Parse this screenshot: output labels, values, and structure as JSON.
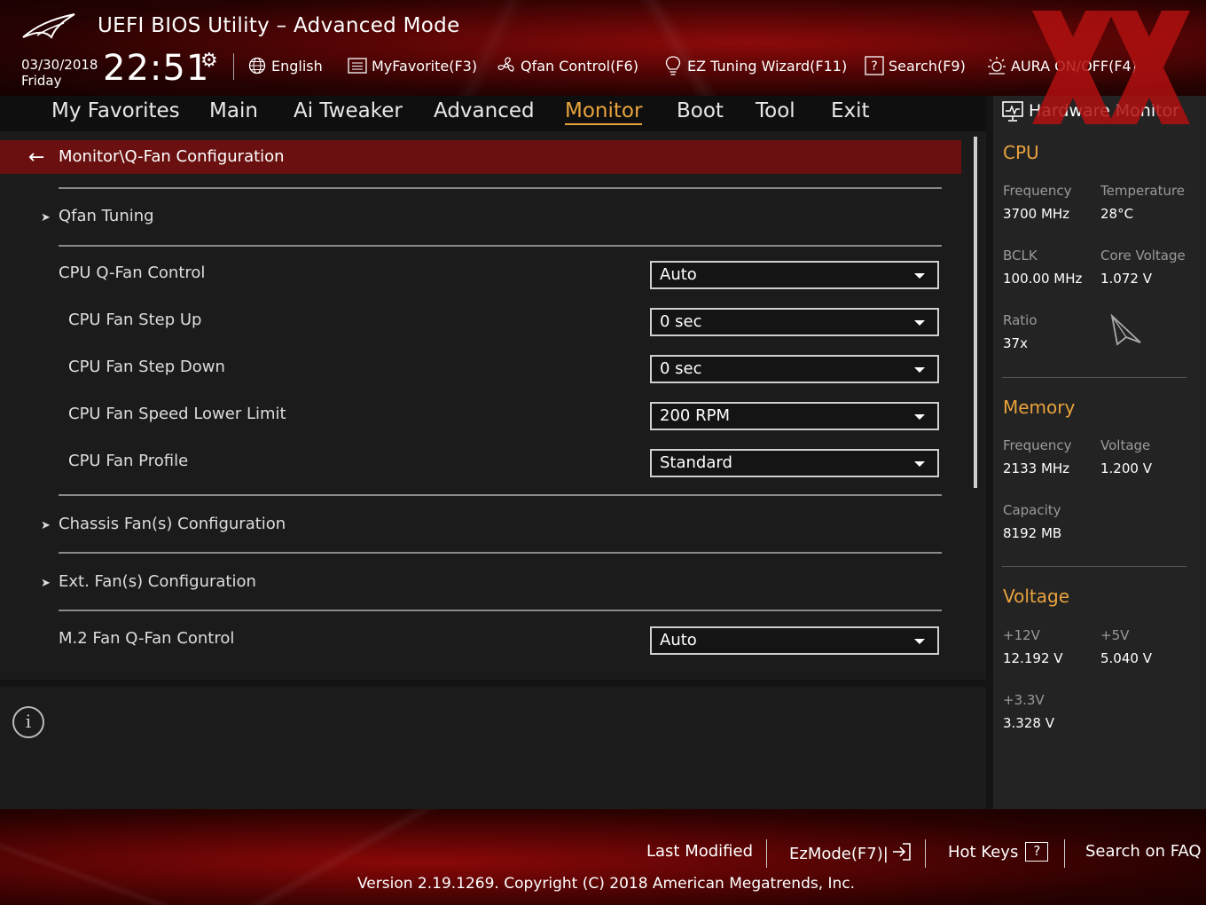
{
  "header": {
    "title": "UEFI BIOS Utility – Advanced Mode",
    "date": "03/30/2018",
    "day": "Friday",
    "time": "22:51",
    "language": "English",
    "myfavorite": "MyFavorite(F3)",
    "qfan": "Qfan Control(F6)",
    "ez_tuning": "EZ Tuning Wizard(F11)",
    "search": "Search(F9)",
    "aura": "AURA ON/OFF(F4)"
  },
  "nav": {
    "tabs": [
      "My Favorites",
      "Main",
      "Ai Tweaker",
      "Advanced",
      "Monitor",
      "Boot",
      "Tool",
      "Exit"
    ],
    "active": "Monitor"
  },
  "main": {
    "breadcrumb": "Monitor\\Q-Fan Configuration",
    "submenus": {
      "qfan_tuning": "Qfan Tuning",
      "chassis": "Chassis Fan(s) Configuration",
      "ext": "Ext. Fan(s) Configuration"
    },
    "settings": [
      {
        "label": "CPU Q-Fan Control",
        "value": "Auto"
      },
      {
        "label": "CPU Fan Step Up",
        "value": "0 sec"
      },
      {
        "label": "CPU Fan Step Down",
        "value": "0 sec"
      },
      {
        "label": "CPU Fan Speed Lower Limit",
        "value": "200 RPM"
      },
      {
        "label": "CPU Fan Profile",
        "value": "Standard"
      },
      {
        "label": "M.2 Fan Q-Fan Control",
        "value": "Auto"
      }
    ]
  },
  "hw": {
    "title": "Hardware Monitor",
    "cpu": {
      "heading": "CPU",
      "frequency_label": "Frequency",
      "frequency": "3700 MHz",
      "temperature_label": "Temperature",
      "temperature": "28°C",
      "bclk_label": "BCLK",
      "bclk": "100.00 MHz",
      "core_voltage_label": "Core Voltage",
      "core_voltage": "1.072 V",
      "ratio_label": "Ratio",
      "ratio": "37x"
    },
    "memory": {
      "heading": "Memory",
      "frequency_label": "Frequency",
      "frequency": "2133 MHz",
      "voltage_label": "Voltage",
      "voltage": "1.200 V",
      "capacity_label": "Capacity",
      "capacity": "8192 MB"
    },
    "voltage": {
      "heading": "Voltage",
      "v12_label": "+12V",
      "v12": "12.192 V",
      "v5_label": "+5V",
      "v5": "5.040 V",
      "v33_label": "+3.3V",
      "v33": "3.328 V"
    }
  },
  "footer": {
    "last_modified": "Last Modified",
    "ezmode": "EzMode(F7)|",
    "hotkeys": "Hot Keys",
    "hotkeys_key": "?",
    "faq": "Search on FAQ",
    "version": "Version 2.19.1269. Copyright (C) 2018 American Megatrends, Inc."
  },
  "colors": {
    "accent": "#e8a33d",
    "breadcrumb_bg": "#6a1010",
    "panel_bg": "#1b1b1b"
  }
}
